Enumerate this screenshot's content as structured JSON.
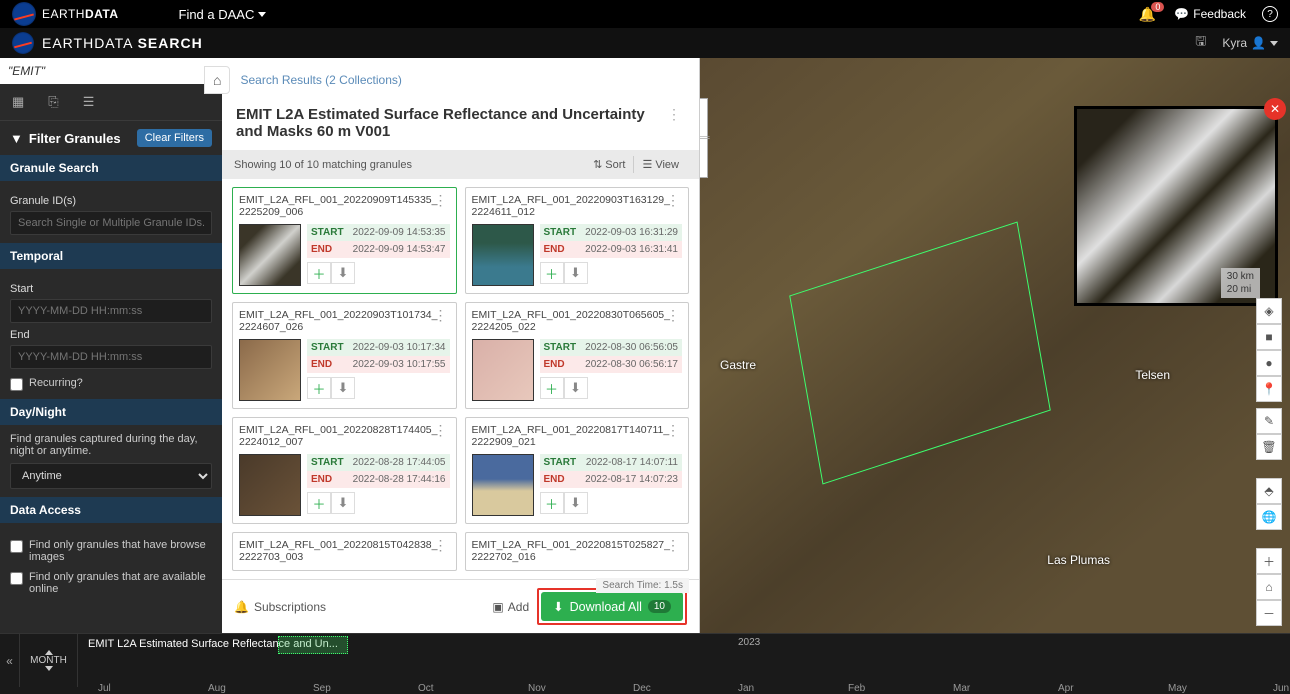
{
  "topbar": {
    "brand_pre": "EARTH",
    "brand_bold": "DATA",
    "find_daac": "Find a DAAC",
    "bell_count": "0",
    "feedback": "Feedback"
  },
  "appbar": {
    "title_pre": "EARTHDATA",
    "title_bold": "SEARCH",
    "user": "Kyra"
  },
  "search": {
    "query": "\"EMIT\""
  },
  "filters": {
    "header": "Filter Granules",
    "clear": "Clear Filters",
    "granule_search": "Granule Search",
    "granule_ids_label": "Granule ID(s)",
    "granule_ids_placeholder": "Search Single or Multiple Granule IDs...",
    "temporal": "Temporal",
    "start_label": "Start",
    "end_label": "End",
    "dt_placeholder": "YYYY-MM-DD HH:mm:ss",
    "recurring": "Recurring?",
    "daynight": "Day/Night",
    "daynight_desc": "Find granules captured during the day, night or anytime.",
    "anytime": "Anytime",
    "data_access": "Data Access",
    "browse_only": "Find only granules that have browse images",
    "online_only": "Find only granules that are available online"
  },
  "results": {
    "breadcrumb": "Search Results (2 Collections)",
    "collection_title": "EMIT L2A Estimated Surface Reflectance and Uncertainty and Masks 60 m V001",
    "count_text": "Showing 10 of 10 matching granules",
    "sort": "Sort",
    "view": "View",
    "search_time": "Search Time: 1.5s",
    "subscriptions": "Subscriptions",
    "add": "Add",
    "download_all": "Download All",
    "download_count": "10"
  },
  "granules": [
    {
      "name": "EMIT_L2A_RFL_001_20220909T145335_2225209_006",
      "start": "2022-09-09 14:53:35",
      "end": "2022-09-09 14:53:47",
      "thumb": "cloudy",
      "selected": true
    },
    {
      "name": "EMIT_L2A_RFL_001_20220903T163129_2224611_012",
      "start": "2022-09-03 16:31:29",
      "end": "2022-09-03 16:31:41",
      "thumb": "ocean"
    },
    {
      "name": "EMIT_L2A_RFL_001_20220903T101734_2224607_026",
      "start": "2022-09-03 10:17:34",
      "end": "2022-09-03 10:17:55",
      "thumb": "desert"
    },
    {
      "name": "EMIT_L2A_RFL_001_20220830T065605_2224205_022",
      "start": "2022-08-30 06:56:05",
      "end": "2022-08-30 06:56:17",
      "thumb": "pink"
    },
    {
      "name": "EMIT_L2A_RFL_001_20220828T174405_2224012_007",
      "start": "2022-08-28 17:44:05",
      "end": "2022-08-28 17:44:16",
      "thumb": "rock"
    },
    {
      "name": "EMIT_L2A_RFL_001_20220817T140711_2222909_021",
      "start": "2022-08-17 14:07:11",
      "end": "2022-08-17 14:07:23",
      "thumb": "bluesand"
    },
    {
      "name": "EMIT_L2A_RFL_001_20220815T042838_2222703_003",
      "start": "",
      "end": "",
      "thumb": ""
    },
    {
      "name": "EMIT_L2A_RFL_001_20220815T025827_2222702_016",
      "start": "",
      "end": "",
      "thumb": ""
    }
  ],
  "labels": {
    "start": "START",
    "end": "END"
  },
  "map": {
    "gastre": "Gastre",
    "telsen": "Telsen",
    "lasplumas": "Las Plumas",
    "scale_km": "30 km",
    "scale_mi": "20 mi"
  },
  "timeline": {
    "interval": "MONTH",
    "title": "EMIT L2A Estimated Surface Reflectance and Un...",
    "year": "2023",
    "ticks": [
      "Jul",
      "Aug",
      "Sep",
      "Oct",
      "Nov",
      "Dec",
      "Jan",
      "Feb",
      "Mar",
      "Apr",
      "May",
      "Jun"
    ]
  }
}
